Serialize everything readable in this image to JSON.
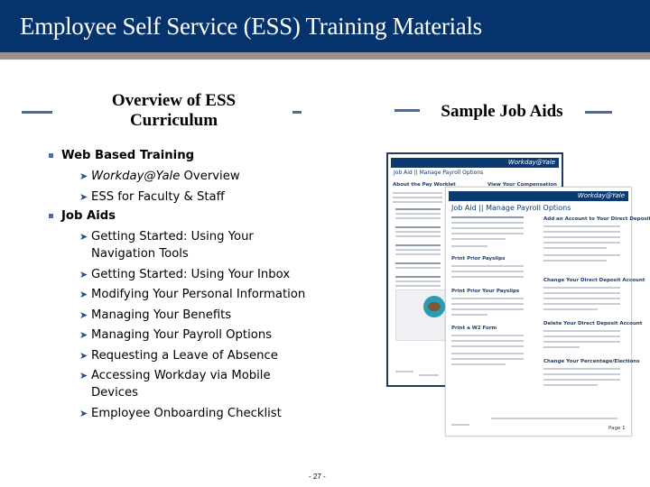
{
  "header": {
    "title": "Employee Self Service (ESS) Training Materials"
  },
  "colors": {
    "title_bar": "#04346b",
    "rule": "#9b918a",
    "accent": "#4a6da0"
  },
  "left_section": {
    "heading_line1": "Overview of ESS",
    "heading_line2": "Curriculum",
    "groups": [
      {
        "label": "Web Based Training",
        "items": [
          {
            "italic": "Workday@Yale",
            "text": " Overview"
          },
          {
            "italic": "",
            "text": "ESS for Faculty & Staff"
          }
        ]
      },
      {
        "label": "Job Aids",
        "items": [
          {
            "text": "Getting Started: Using Your Navigation Tools"
          },
          {
            "text": "Getting Started: Using Your Inbox"
          },
          {
            "text": "Modifying Your Personal Information"
          },
          {
            "text": "Managing Your Benefits"
          },
          {
            "text": "Managing Your Payroll Options"
          },
          {
            "text": "Requesting a Leave of Absence"
          },
          {
            "text": "Accessing Workday via Mobile Devices"
          },
          {
            "text": "Employee Onboarding Checklist"
          }
        ]
      }
    ]
  },
  "right_section": {
    "heading": "Sample Job Aids",
    "back_doc": {
      "brand": "Workday@Yale",
      "title": "Job Aid || Manage Payroll Options",
      "sub_left": "About the Pay Worklet",
      "sub_right": "View Your Compensation"
    },
    "front_doc": {
      "brand": "Workday@Yale",
      "title": "Job Aid || Manage Payroll Options",
      "sections": [
        "Print Prior Payslips",
        "Print Prior Your Payslips",
        "Print a W2 Form",
        "Add an Account to Your Direct Deposit",
        "Change Your Direct Deposit Account",
        "Delete Your Direct Deposit Account",
        "Change Your Percentage/Elections"
      ],
      "footer_page": "Page 1"
    }
  },
  "footer": {
    "page_number": "- 27 -"
  }
}
